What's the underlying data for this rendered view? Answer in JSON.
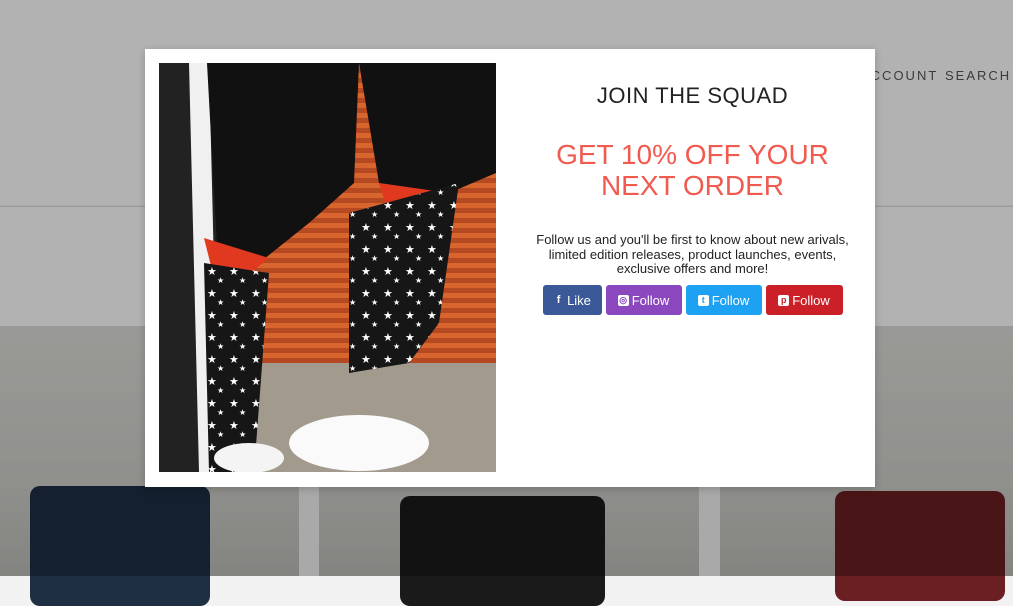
{
  "header": {
    "nav_account": "ACCOUNT",
    "nav_search": "SEARCH"
  },
  "popup": {
    "title": "JOIN THE SQUAD",
    "offer": "GET 10% OFF YOUR NEXT ORDER",
    "description": "Follow us and you'll be first to know about new arivals, limited edition releases, product launches, events, exclusive offers and more!",
    "buttons": [
      {
        "icon": "facebook-icon",
        "glyph": "f",
        "label": "Like",
        "color": "#3b5998"
      },
      {
        "icon": "instagram-icon",
        "glyph": "◎",
        "label": "Follow",
        "color": "#8a47be"
      },
      {
        "icon": "twitter-icon",
        "glyph": "t",
        "label": "Follow",
        "color": "#1da1f2"
      },
      {
        "icon": "pinterest-icon",
        "glyph": "p",
        "label": "Follow",
        "color": "#cb2027"
      }
    ]
  },
  "colors": {
    "offer_accent": "#f05a4f",
    "overlay": "rgba(0,0,0,0.3)"
  }
}
